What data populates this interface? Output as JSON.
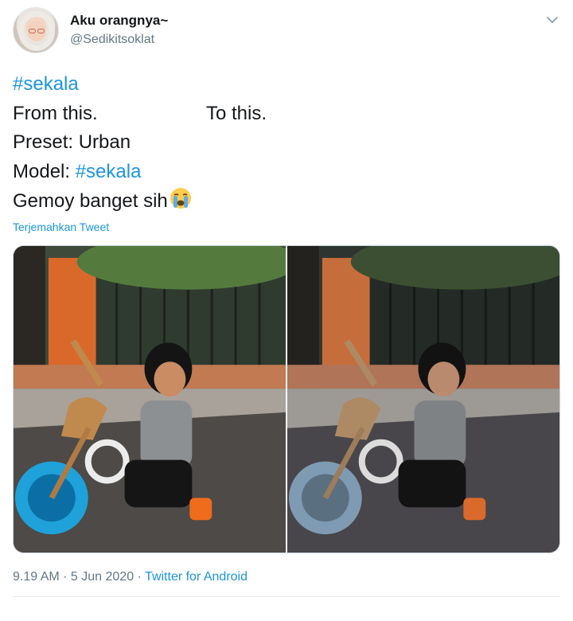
{
  "user": {
    "display_name": "Aku orangnya~",
    "handle": "@Sedikitsoklat"
  },
  "tweet": {
    "hashtag_1": "#sekala",
    "from_text": "From this.",
    "to_text": "To this.",
    "preset_text": "Preset: Urban",
    "model_prefix": "Model: ",
    "hashtag_2": "#sekala",
    "closing_text": "Gemoy banget sih",
    "emoji": "loudly-crying-face-icon"
  },
  "translate_label": "Terjemahkan Tweet",
  "media": {
    "photos": [
      {
        "label": "original photo",
        "tone": "warm"
      },
      {
        "label": "edited photo",
        "tone": "urban"
      }
    ]
  },
  "meta": {
    "time": "9.19 AM",
    "separator": " · ",
    "date": "5 Jun 2020",
    "source": "Twitter for Android"
  },
  "colors": {
    "link": "#1b95e0",
    "text": "#14171a",
    "secondary": "#657786"
  }
}
